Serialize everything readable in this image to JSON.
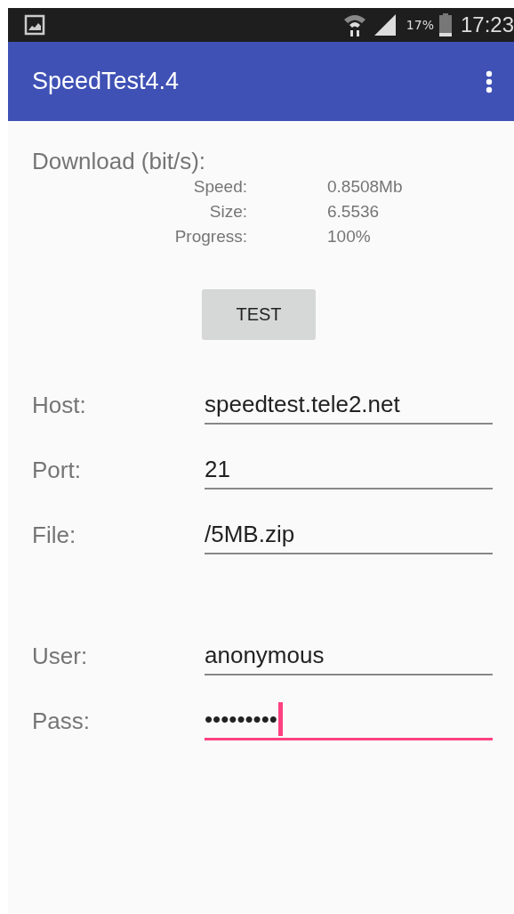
{
  "status_bar": {
    "battery": "17%",
    "time": "17:23"
  },
  "app_bar": {
    "title": "SpeedTest4.4"
  },
  "download": {
    "heading": "Download (bit/s):",
    "stats": [
      {
        "label": "Speed:",
        "value": "0.8508Mb"
      },
      {
        "label": "Size:",
        "value": "6.5536"
      },
      {
        "label": "Progress:",
        "value": "100%"
      }
    ]
  },
  "test_button": "TEST",
  "server_fields": [
    {
      "label": "Host:",
      "value": "speedtest.tele2.net",
      "focused": false
    },
    {
      "label": "Port:",
      "value": "21",
      "focused": false
    },
    {
      "label": "File:",
      "value": "/5MB.zip",
      "focused": false
    }
  ],
  "login_fields": [
    {
      "label": "User:",
      "value": "anonymous",
      "focused": false
    },
    {
      "label": "Pass:",
      "value": "•••••••••",
      "focused": true
    }
  ]
}
